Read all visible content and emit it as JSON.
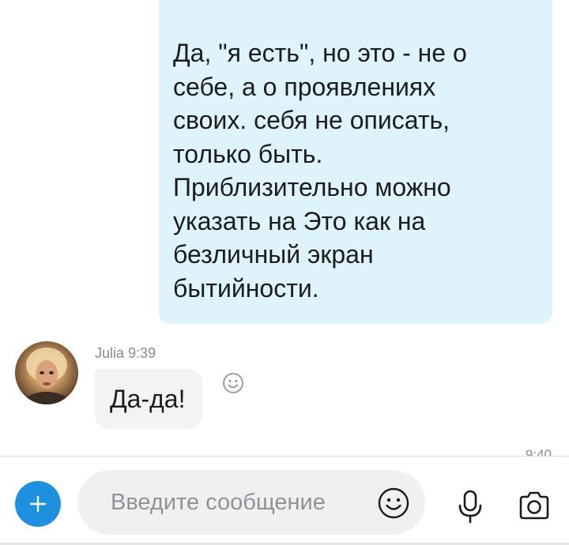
{
  "messages": {
    "outgoing": {
      "text": "Да, \"я есть\", но это - не о\nсебе, а о проявлениях\nсвоих. себя не описать,\nтолько быть.\nПриблизительно можно\nуказать на Это как на\nбезличный экран\nбытийности."
    },
    "incoming": {
      "sender": "Julia",
      "time": "9:39",
      "text": "Да-да!"
    },
    "partial_timestamp": "9:40"
  },
  "composer": {
    "placeholder": "Введите сообщение"
  },
  "colors": {
    "outgoing_bubble": "#dff3fd",
    "incoming_bubble": "#f1f3f5",
    "accent": "#1f8fe0",
    "muted_text": "#8a8a8a"
  },
  "icons": {
    "add": "plus-icon",
    "reaction": "smiley-icon",
    "emoji": "emoji-icon",
    "voice": "microphone-icon",
    "camera": "camera-icon"
  }
}
